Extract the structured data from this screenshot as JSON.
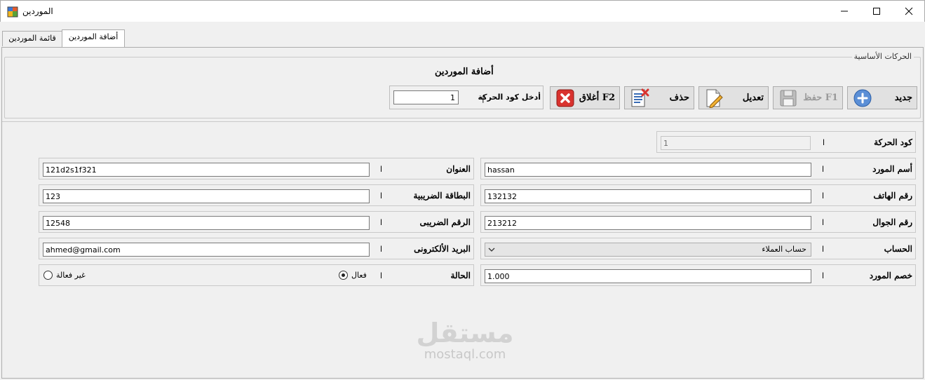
{
  "window": {
    "title": "الموردين"
  },
  "tabs": [
    {
      "label": "قائمة الموردين",
      "selected": false
    },
    {
      "label": "أضافة الموردين",
      "selected": true
    }
  ],
  "toolbar_group": {
    "legend": "الحركات الأساسية",
    "form_title": "أضافة الموردين",
    "code_label": "أدخل كود الحركة",
    "code_separator": "|",
    "code_value": "1",
    "buttons": {
      "new": {
        "label": "جديد",
        "icon": "plus-circle-icon"
      },
      "save": {
        "label": "حفظ F1",
        "icon": "floppy-disk-icon",
        "disabled": true
      },
      "edit": {
        "label": "تعديل",
        "icon": "edit-document-icon"
      },
      "delete": {
        "label": "حذف",
        "icon": "delete-document-icon"
      },
      "close": {
        "label": "أغلاق F2",
        "icon": "red-x-icon"
      }
    }
  },
  "separator": "ا",
  "fields": {
    "transaction_code": {
      "label": "كود الحركة",
      "value": "1"
    },
    "supplier_name": {
      "label": "أسم المورد",
      "value": "hassan"
    },
    "phone": {
      "label": "رقم الهاتف",
      "value": "132132"
    },
    "mobile": {
      "label": "رقم الجوال",
      "value": "213212"
    },
    "account": {
      "label": "الحساب",
      "value": "حساب العملاء"
    },
    "supplier_discount": {
      "label": "خصم المورد",
      "value": "1.000"
    },
    "address": {
      "label": "العنوان",
      "value": "121d2s1f321"
    },
    "tax_card": {
      "label": "البطاقة الضريبية",
      "value": "123"
    },
    "tax_number": {
      "label": "الرقم الضريبى",
      "value": "12548"
    },
    "email": {
      "label": "البريد الألكترونى",
      "value": "ahmed@gmail.com"
    },
    "status": {
      "label": "الحالة",
      "options": [
        {
          "label": "فعال",
          "checked": true
        },
        {
          "label": "غير فعالة",
          "checked": false
        }
      ]
    }
  },
  "watermark": {
    "logo": "مستقل",
    "url": "mostaql.com"
  }
}
